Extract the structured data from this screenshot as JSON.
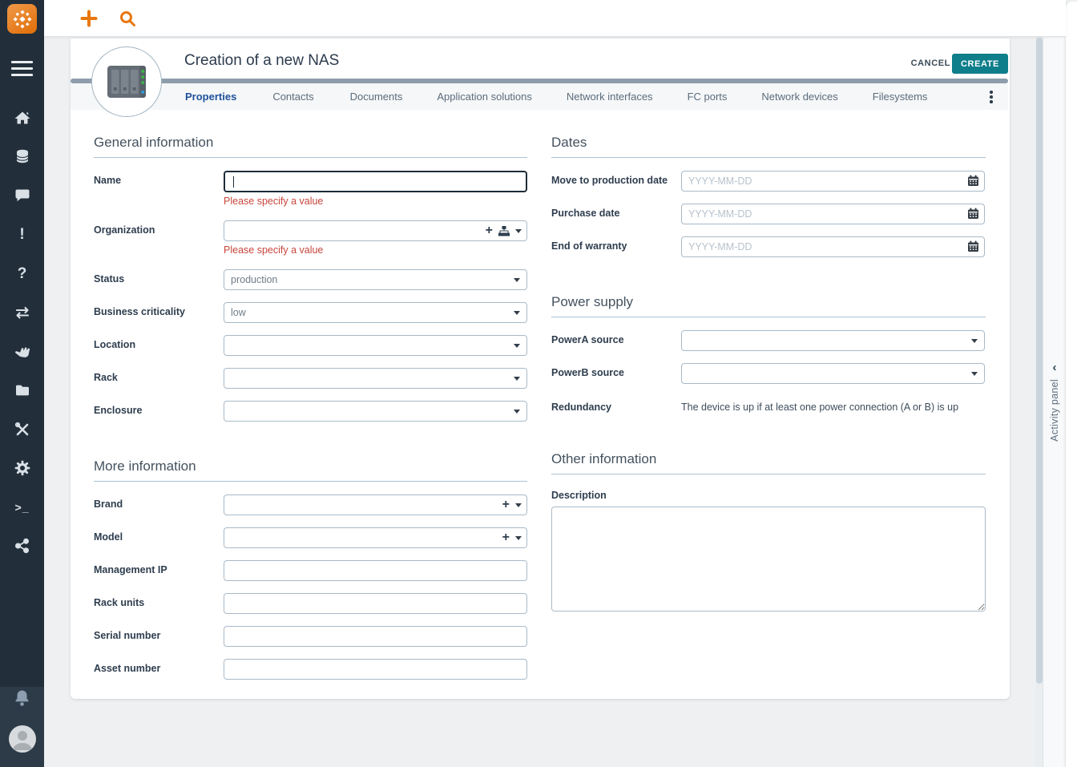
{
  "header": {
    "title": "Creation of a new NAS",
    "cancel_label": "CANCEL",
    "create_label": "CREATE"
  },
  "tabs": [
    {
      "label": "Properties",
      "active": true
    },
    {
      "label": "Contacts",
      "active": false
    },
    {
      "label": "Documents",
      "active": false
    },
    {
      "label": "Application solutions",
      "active": false
    },
    {
      "label": "Network interfaces",
      "active": false
    },
    {
      "label": "FC ports",
      "active": false
    },
    {
      "label": "Network devices",
      "active": false
    },
    {
      "label": "Filesystems",
      "active": false
    }
  ],
  "form": {
    "general": {
      "title": "General information",
      "name_label": "Name",
      "name_value": "",
      "name_error": "Please specify a value",
      "organization_label": "Organization",
      "organization_value": "",
      "organization_error": "Please specify a value",
      "status_label": "Status",
      "status_value": "production",
      "criticality_label": "Business criticality",
      "criticality_value": "low",
      "location_label": "Location",
      "location_value": "",
      "rack_label": "Rack",
      "rack_value": "",
      "enclosure_label": "Enclosure",
      "enclosure_value": ""
    },
    "more": {
      "title": "More information",
      "brand_label": "Brand",
      "brand_value": "",
      "model_label": "Model",
      "model_value": "",
      "management_ip_label": "Management IP",
      "management_ip_value": "",
      "rack_units_label": "Rack units",
      "rack_units_value": "",
      "serial_label": "Serial number",
      "serial_value": "",
      "asset_label": "Asset number",
      "asset_value": ""
    },
    "dates": {
      "title": "Dates",
      "move_label": "Move to production date",
      "purchase_label": "Purchase date",
      "warranty_label": "End of warranty",
      "date_placeholder": "YYYY-MM-DD"
    },
    "power": {
      "title": "Power supply",
      "powera_label": "PowerA source",
      "powera_value": "",
      "powerb_label": "PowerB source",
      "powerb_value": "",
      "redundancy_label": "Redundancy",
      "redundancy_text": "The device is up if at least one power connection (A or B) is up"
    },
    "other": {
      "title": "Other information",
      "description_label": "Description",
      "description_value": ""
    }
  },
  "activity_panel": {
    "label": "Activity panel"
  },
  "glyphs": {
    "plus": "+",
    "exclamation": "!",
    "question": "?",
    "terminal": ">_",
    "chevron_left": "‹"
  },
  "sidebar": {
    "icons": [
      "itop-logo",
      "menu",
      "home",
      "database",
      "chat",
      "exclamation",
      "question",
      "transfer",
      "helping-hand",
      "folder",
      "tools",
      "gear",
      "terminal",
      "share",
      "bell",
      "avatar"
    ]
  },
  "colors": {
    "accent_orange": "#e8770e",
    "create_teal": "#0f7e8b",
    "active_tab_blue": "#20519b",
    "error_red": "#c8463c",
    "sidebar_bg": "#222f3b",
    "tabstrip_gray": "#8e9dab"
  }
}
